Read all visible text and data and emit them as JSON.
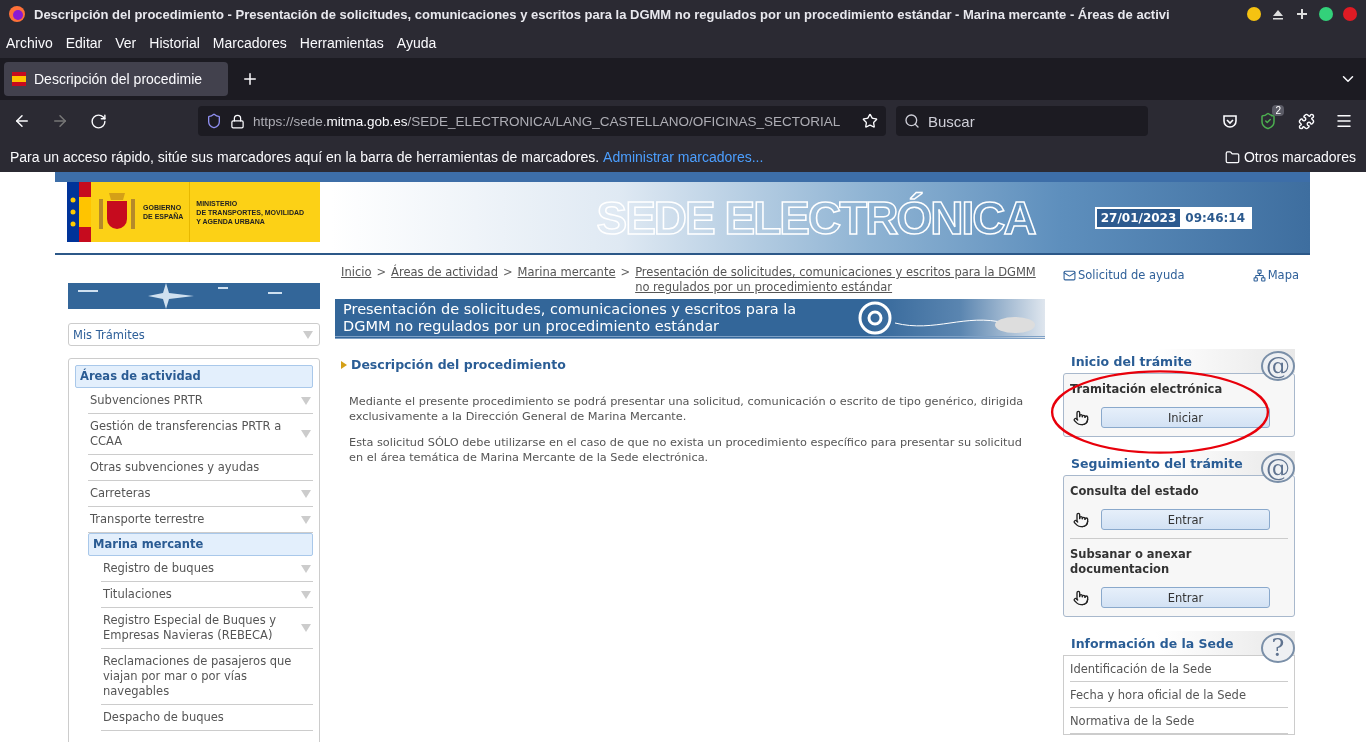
{
  "window": {
    "title": "Descripción del procedimiento - Presentación de solicitudes, comunicaciones y escritos para la DGMM no regulados por un procedimiento estándar - Marina mercante - Áreas de activi"
  },
  "menu": [
    "Archivo",
    "Editar",
    "Ver",
    "Historial",
    "Marcadores",
    "Herramientas",
    "Ayuda"
  ],
  "tabs": [
    {
      "label": "Descripción del procedimie",
      "selected": true
    }
  ],
  "address_bar": {
    "scheme": "https://sede.",
    "domain": "mitma.gob.es",
    "path": "/SEDE_ELECTRONICA/LANG_CASTELLANO/OFICINAS_SECTORIAL"
  },
  "search": {
    "placeholder": "Buscar"
  },
  "extension_badge": "2",
  "bookmarks_bar": {
    "hint": "Para un acceso rápido, sitúe sus marcadores aquí en la barra de herramientas de marcadores.",
    "link": "Administrar marcadores...",
    "other": "Otros marcadores"
  },
  "site_header": {
    "government": [
      "GOBIERNO",
      "DE ESPAÑA"
    ],
    "ministry": [
      "MINISTERIO",
      "DE TRANSPORTES, MOVILIDAD",
      "Y AGENDA URBANA"
    ],
    "banner_title": "SEDE ELECTRÓNICA",
    "date": "27/01/2023",
    "time": "09:46:14"
  },
  "breadcrumb": {
    "items": [
      "Inicio",
      "Áreas de actividad",
      "Marina mercante",
      "Presentación de solicitudes, comunicaciones y escritos para la DGMM no regulados por un procedimiento estándar"
    ],
    "separators": [
      ">",
      ">",
      ">"
    ]
  },
  "top_links": [
    {
      "kind": "help",
      "label": "Solicitud de ayuda"
    },
    {
      "kind": "map",
      "label": "Mapa"
    }
  ],
  "sidebar": {
    "dropdown": "Mis Trámites",
    "tree": [
      {
        "label": "Áreas de actividad",
        "selected": true,
        "expandable": false,
        "children": [
          {
            "label": "Subvenciones PRTR",
            "selected": false,
            "expandable": true
          },
          {
            "label": "Gestión de transferencias PRTR a CCAA",
            "selected": false,
            "expandable": true
          },
          {
            "label": "Otras subvenciones y ayudas",
            "selected": false,
            "expandable": false
          },
          {
            "label": "Carreteras",
            "selected": false,
            "expandable": true
          },
          {
            "label": "Transporte terrestre",
            "selected": false,
            "expandable": true
          },
          {
            "label": "Marina mercante",
            "selected": true,
            "expandable": false,
            "children": [
              {
                "label": "Registro de buques",
                "selected": false,
                "expandable": true
              },
              {
                "label": "Titulaciones",
                "selected": false,
                "expandable": true
              },
              {
                "label": "Registro Especial de Buques y Empresas Navieras (REBECA)",
                "selected": false,
                "expandable": true
              },
              {
                "label": "Reclamaciones de pasajeros que viajan por mar o por vías navegables",
                "selected": false,
                "expandable": false
              },
              {
                "label": "Despacho de buques",
                "selected": false,
                "expandable": false
              }
            ]
          }
        ]
      }
    ]
  },
  "procedure": {
    "title": "Presentación de solicitudes, comunicaciones y escritos para la DGMM no regulados por un procedimiento estándar",
    "section_heading": "Descripción del procedimiento",
    "paragraphs": [
      "Mediante el presente procedimiento se podrá presentar una solicitud, comunicación o escrito de tipo genérico, dirigida exclusivamente a la Dirección General de Marina Mercante.",
      "Esta solicitud SÓLO debe utilizarse en el caso de que no exista un procedimiento específico para presentar su solicitud en el área temática de Marina Mercante de la Sede electrónica."
    ]
  },
  "right_panel": [
    {
      "kind": "actions",
      "heading": "Inicio del trámite",
      "badge": "@",
      "highlighted": true,
      "groups": [
        {
          "label": "Tramitación electrónica",
          "button": "Iniciar"
        }
      ]
    },
    {
      "kind": "actions",
      "heading": "Seguimiento del trámite",
      "badge": "@",
      "highlighted": false,
      "groups": [
        {
          "label": "Consulta del estado",
          "button": "Entrar"
        },
        {
          "label": "Subsanar o anexar documentacion",
          "button": "Entrar"
        }
      ]
    },
    {
      "kind": "links",
      "heading": "Información de la Sede",
      "badge": "?",
      "highlighted": false,
      "links": [
        "Identificación de la Sede",
        "Fecha y hora oficial de la Sede",
        "Normativa de la Sede"
      ]
    }
  ]
}
